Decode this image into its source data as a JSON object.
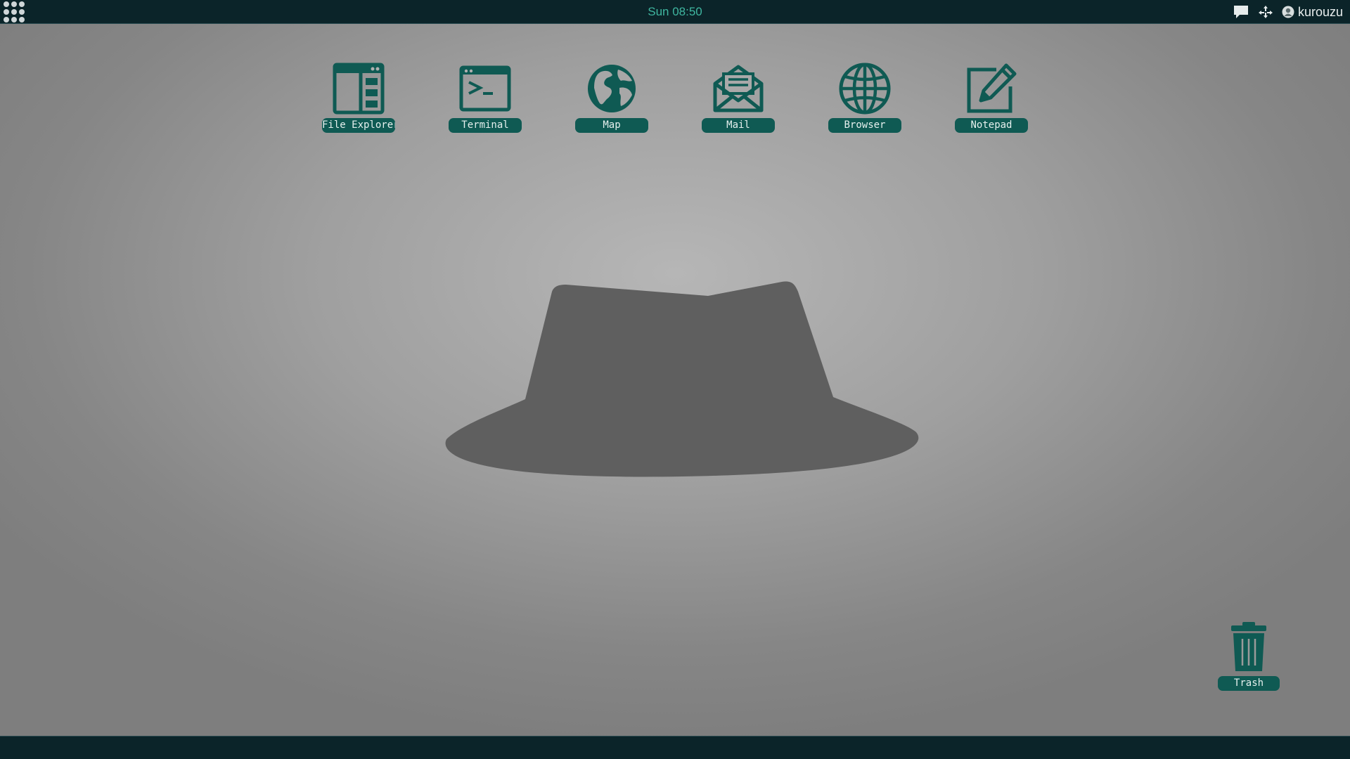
{
  "topbar": {
    "clock": "Sun 08:50",
    "user_name": "kurouzu",
    "launcher_icon": "app-grid-icon",
    "tray_icons": [
      "chat-icon",
      "network-icon",
      "user-icon"
    ]
  },
  "desktop": {
    "icons": [
      {
        "label": "File Explorer",
        "icon": "file-explorer-icon"
      },
      {
        "label": "Terminal",
        "icon": "terminal-icon"
      },
      {
        "label": "Map",
        "icon": "globe-map-icon"
      },
      {
        "label": "Mail",
        "icon": "mail-icon"
      },
      {
        "label": "Browser",
        "icon": "browser-globe-icon"
      },
      {
        "label": "Notepad",
        "icon": "notepad-icon"
      }
    ],
    "trash": {
      "label": "Trash",
      "icon": "trash-icon"
    },
    "wallpaper": "fedora-hat-silhouette"
  },
  "colors": {
    "topbar_bg": "#0b2429",
    "clock_text": "#3fb6a0",
    "icon_teal": "#0f5a53",
    "hat_fill": "#5f5f5f"
  }
}
